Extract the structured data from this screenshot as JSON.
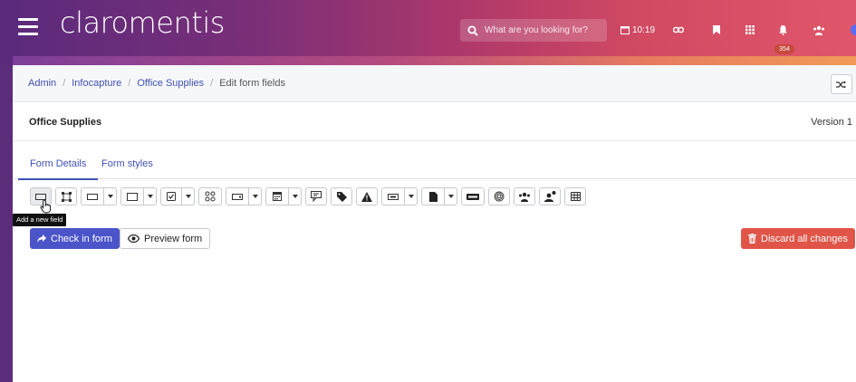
{
  "brand": "claromentis",
  "search": {
    "placeholder": "What are you looking for?"
  },
  "topbar": {
    "time": "10:19",
    "notification_count": "354"
  },
  "breadcrumb": {
    "items": [
      "Admin",
      "Infocapture",
      "Office Supplies"
    ],
    "current": "Edit form fields"
  },
  "form": {
    "title": "Office Supplies",
    "version": "Version 1"
  },
  "tabs": [
    {
      "label": "Form Details",
      "active": true
    },
    {
      "label": "Form styles",
      "active": false
    }
  ],
  "toolbar": {
    "tooltip": "Add a new field",
    "tools": [
      "text-field-icon",
      "resize-box-icon",
      "input-dropdown-icon",
      "textarea-dropdown-icon",
      "checkbox-dropdown-icon",
      "grid-options-icon",
      "select-dropdown-icon",
      "calendar-dropdown-icon",
      "comment-icon",
      "tag-icon",
      "warning-icon",
      "label-dropdown-icon",
      "file-dropdown-icon",
      "html-icon",
      "fingerprint-icon",
      "users-group-icon",
      "user-location-icon",
      "table-icon"
    ]
  },
  "buttons": {
    "check_in": "Check in form",
    "preview": "Preview form",
    "discard": "Discard all changes"
  },
  "colors": {
    "primary": "#4b55c9",
    "danger": "#e05548",
    "link": "#3f51b5"
  }
}
